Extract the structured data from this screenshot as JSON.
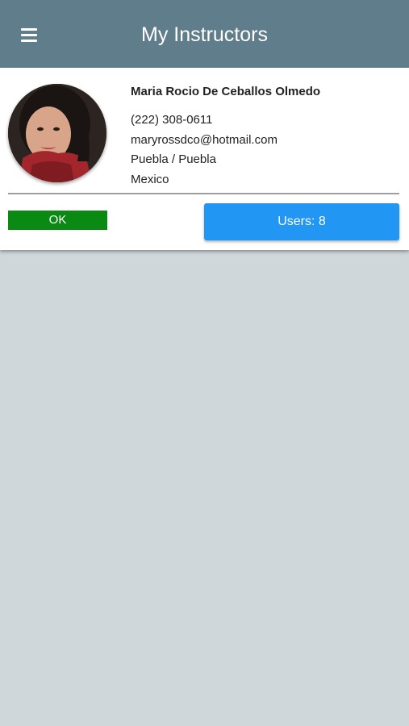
{
  "header": {
    "title": "My Instructors",
    "menu_icon": "hamburger-menu-icon"
  },
  "instructor": {
    "name": "Maria Rocio De Ceballos Olmedo",
    "phone": "(222) 308-0611",
    "email": "maryrossdco@hotmail.com",
    "location": "Puebla / Puebla",
    "country": "Mexico",
    "status_label": "OK",
    "users_label": "Users: 8"
  },
  "colors": {
    "header_bg": "#607d8b",
    "page_bg": "#d0d7db",
    "status_ok": "#0a8a12",
    "users_button": "#2196f3"
  }
}
